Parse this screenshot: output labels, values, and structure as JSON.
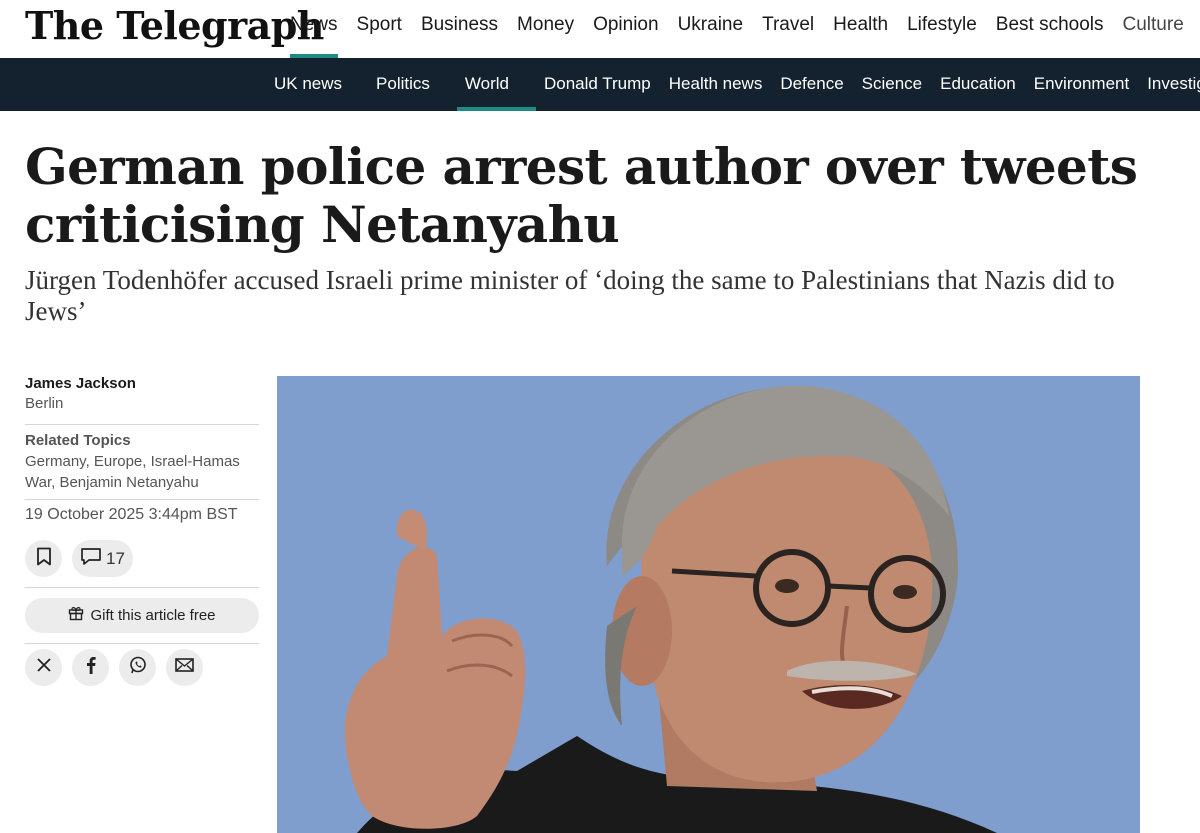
{
  "masthead": {
    "logo": "The Telegraph",
    "nav": [
      "News",
      "Sport",
      "Business",
      "Money",
      "Opinion",
      "Ukraine",
      "Travel",
      "Health",
      "Lifestyle",
      "Best schools",
      "Culture"
    ],
    "active": "News",
    "accent_color": "#1f8a86"
  },
  "subnav": {
    "items": [
      "UK news",
      "Politics",
      "World",
      "Donald Trump",
      "Health news",
      "Defence",
      "Science",
      "Education",
      "Environment",
      "Investig"
    ],
    "active": "World",
    "background": "#13222e"
  },
  "article": {
    "headline": "German police arrest author over tweets criticising Netanyahu",
    "standfirst": "Jürgen Todenhöfer accused Israeli prime minister of ‘doing the same to Palestinians that Nazis did to Jews’",
    "author": "James Jackson",
    "location": "Berlin",
    "related_label": "Related Topics",
    "related_topics": "Germany, Europe, Israel-Hamas War, Benjamin Netanyahu",
    "date": "19 October 2025 3:44pm BST",
    "comment_count": "17",
    "gift_label": "Gift this article free"
  },
  "icons": {
    "bookmark": "bookmark-icon",
    "comment": "comment-icon",
    "gift": "gift-icon",
    "x": "x-icon",
    "facebook": "facebook-icon",
    "whatsapp": "whatsapp-icon",
    "email": "email-icon"
  }
}
